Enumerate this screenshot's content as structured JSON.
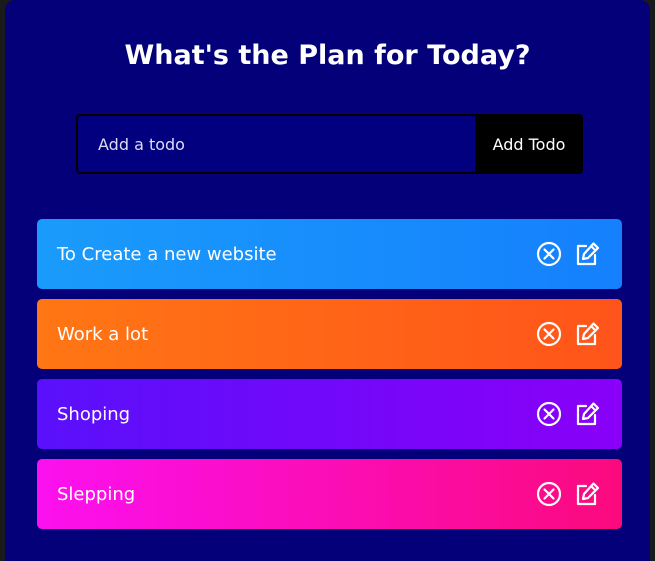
{
  "header": {
    "title": "What's the Plan for Today?"
  },
  "form": {
    "placeholder": "Add a todo",
    "value": "",
    "button_label": "Add Todo"
  },
  "todos": [
    {
      "text": "To Create a new website",
      "gradient_from": "#1a9bfb",
      "gradient_to": "#1580fd"
    },
    {
      "text": "Work a lot",
      "gradient_from": "#ff7614",
      "gradient_to": "#ff541a"
    },
    {
      "text": "Shoping",
      "gradient_from": "#5a10fb",
      "gradient_to": "#8a00f8"
    },
    {
      "text": "Slepping",
      "gradient_from": "#fb10f0",
      "gradient_to": "#fb0a7d"
    }
  ],
  "icons": {
    "delete": "close-circle-icon",
    "edit": "edit-icon"
  },
  "colors": {
    "background": "#03007a",
    "button": "#000000",
    "text": "#ffffff"
  }
}
